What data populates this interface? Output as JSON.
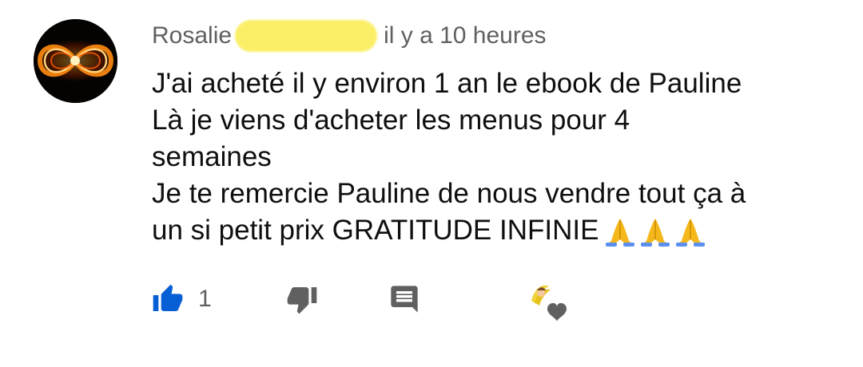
{
  "comment": {
    "author": "Rosalie",
    "timestamp": "il y a 10 heures",
    "lines": [
      "J'ai acheté il y environ 1 an le ebook de Pauline",
      "Là je viens d'acheter les menus pour 4",
      "semaines",
      "Je te remercie Pauline de nous vendre tout ça à",
      "un si petit prix GRATITUDE INFINIE"
    ],
    "emojis": [
      "🙏",
      "🙏",
      "🙏"
    ],
    "like_count": "1"
  },
  "icons": {
    "avatar": "infinity-fire-avatar",
    "like": "thumbs-up-icon",
    "dislike": "thumbs-down-icon",
    "reply": "comment-icon",
    "creator_heart": "creator-heart-icon"
  },
  "colors": {
    "like_active": "#065fd4",
    "icon_gray": "#606060",
    "redaction": "#fbef68"
  }
}
